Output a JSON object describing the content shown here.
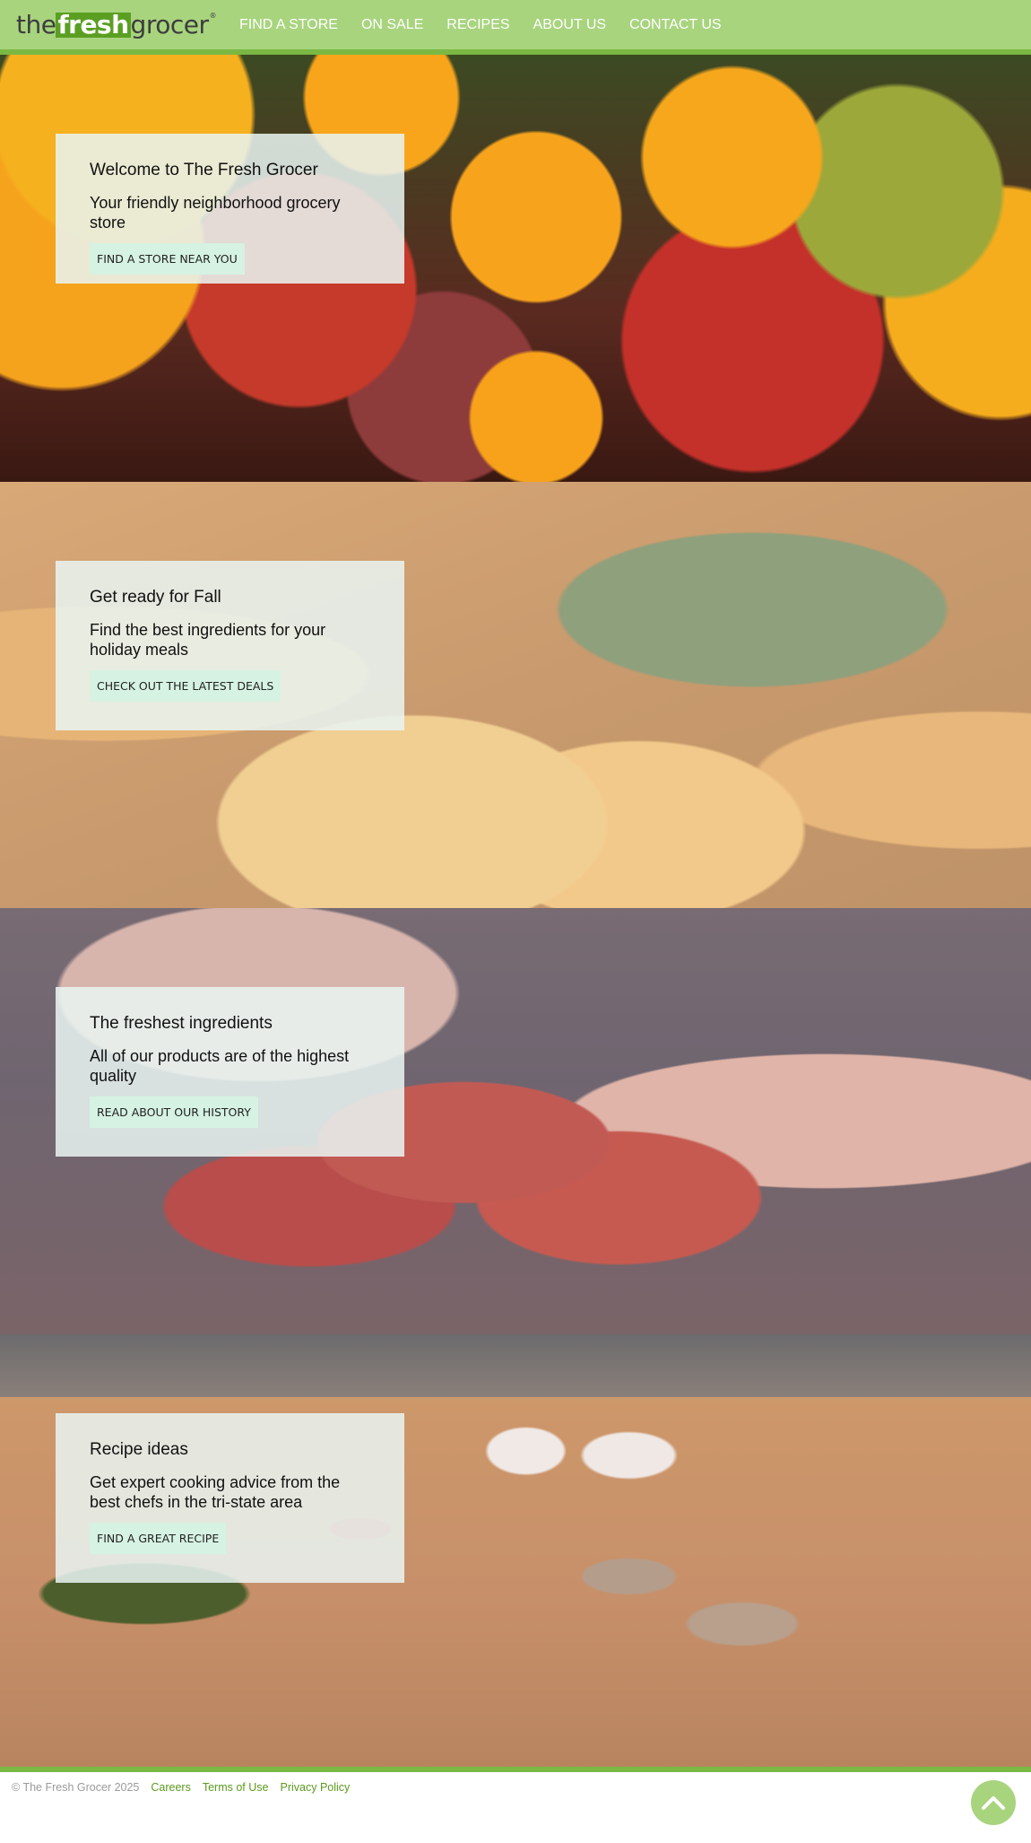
{
  "header": {
    "logo": {
      "the": "the",
      "fresh": "fresh",
      "grocer": "grocer",
      "reg": "®"
    },
    "nav": [
      "FIND A STORE",
      "ON SALE",
      "RECIPES",
      "ABOUT US",
      "CONTACT US"
    ]
  },
  "sections": [
    {
      "title": "Welcome to The Fresh Grocer",
      "text": "Your friendly neighborhood grocery store",
      "button": "FIND A STORE NEAR YOU",
      "image": "citrus-and-pomegranate-photo"
    },
    {
      "title": "Get ready for Fall",
      "text": "Find the best ingredients for your holiday meals",
      "button": "CHECK OUT THE LATEST DEALS",
      "image": "squash-photo"
    },
    {
      "title": "The freshest ingredients",
      "text": "All of our products are of the highest quality",
      "button": "READ ABOUT OUR HISTORY",
      "image": "strawberries-photo"
    },
    {
      "title": "Recipe ideas",
      "text": "Get expert cooking advice from the best chefs in the tri-state area",
      "button": "FIND A GREAT RECIPE",
      "image": "cutting-board-photo"
    }
  ],
  "footer": {
    "copyright": "© The Fresh Grocer 2025",
    "links": [
      "Careers",
      "Terms of Use",
      "Privacy Policy"
    ]
  },
  "back_to_top_icon": "chevron-up-icon",
  "colors": {
    "header": "#a8d47e",
    "accent": "#7ab843",
    "logo_fresh": "#5b9f22",
    "link": "#5c9a1e",
    "button_bg": "#d6f2e2"
  }
}
